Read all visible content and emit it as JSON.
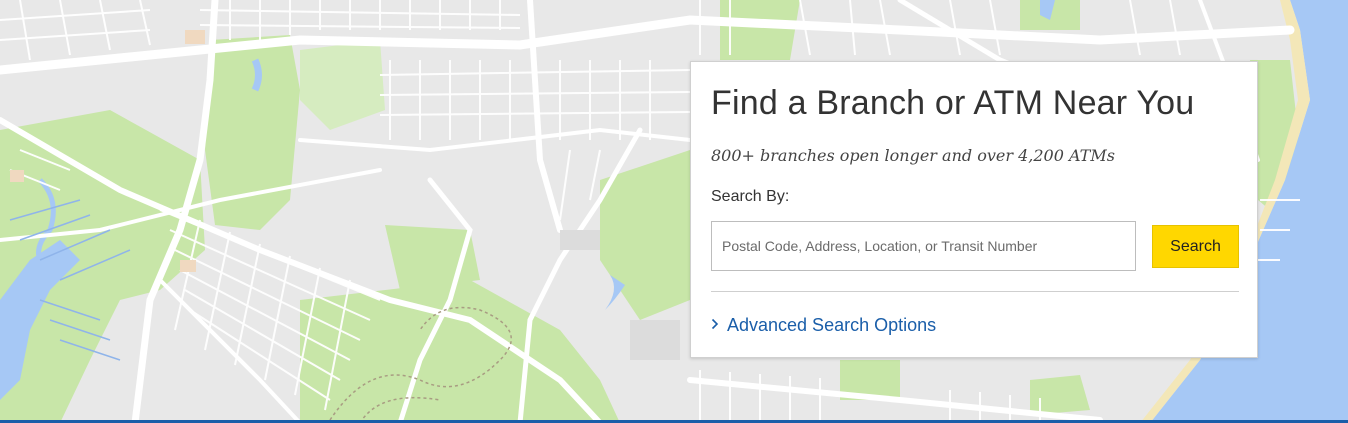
{
  "map": {
    "label": "branch-locator-map-background"
  },
  "locator": {
    "title": "Find a Branch or ATM Near You",
    "subtitle": "800+ branches open longer and over 4,200 ATMs",
    "search_by_label": "Search By:",
    "search_placeholder": "Postal Code, Address, Location, or Transit Number",
    "search_value": "",
    "search_button_label": "Search",
    "advanced_link_label": "Advanced Search Options",
    "advanced_link_icon": "chevron-right-icon"
  },
  "colors": {
    "accent_yellow": "#ffd700",
    "link_blue": "#1a5ea9",
    "park_green": "#c8e6a8",
    "water_blue": "#a6c8f5",
    "map_base": "#e8e8e8"
  }
}
